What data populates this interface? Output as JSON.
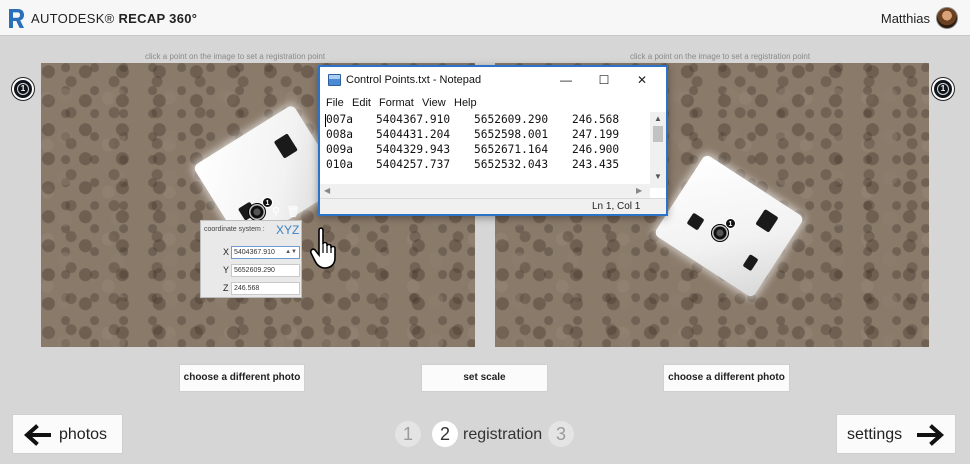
{
  "header": {
    "brand_prefix": "AUTODESK®",
    "brand_product": "RECAP 360°",
    "user_name": "Matthias"
  },
  "hints": {
    "left": "click a point on the image to set a registration point",
    "right": "click a point on the image to set a registration point"
  },
  "markers": {
    "left_side_badge": "1",
    "right_side_badge": "1",
    "left_point_badge": "1",
    "right_point_badge": "1"
  },
  "coordinates": {
    "system_label": "coordinate system :",
    "system_value": "XYZ",
    "x_label": "X",
    "x_value": "5404367.910",
    "y_label": "Y",
    "y_value": "5652609.290",
    "z_label": "Z",
    "z_value": "246.568"
  },
  "notepad": {
    "title": "Control Points.txt - Notepad",
    "menu": [
      "File",
      "Edit",
      "Format",
      "View",
      "Help"
    ],
    "rows": [
      [
        "007a",
        "5404367.910",
        "5652609.290",
        "246.568"
      ],
      [
        "008a",
        "5404431.204",
        "5652598.001",
        "247.199"
      ],
      [
        "009a",
        "5404329.943",
        "5652671.164",
        "246.900"
      ],
      [
        "010a",
        "5404257.737",
        "5652532.043",
        "243.435"
      ]
    ],
    "status": "Ln 1, Col 1"
  },
  "buttons": {
    "choose_left": "choose a different photo",
    "set_scale": "set scale",
    "choose_right": "choose a different photo"
  },
  "nav": {
    "prev_label": "photos",
    "next_label": "settings",
    "step1": "1",
    "step2": "2",
    "step2_label": "registration",
    "step3": "3"
  },
  "colors": {
    "accent": "#3b82c4",
    "window_border": "#2b73c9"
  }
}
